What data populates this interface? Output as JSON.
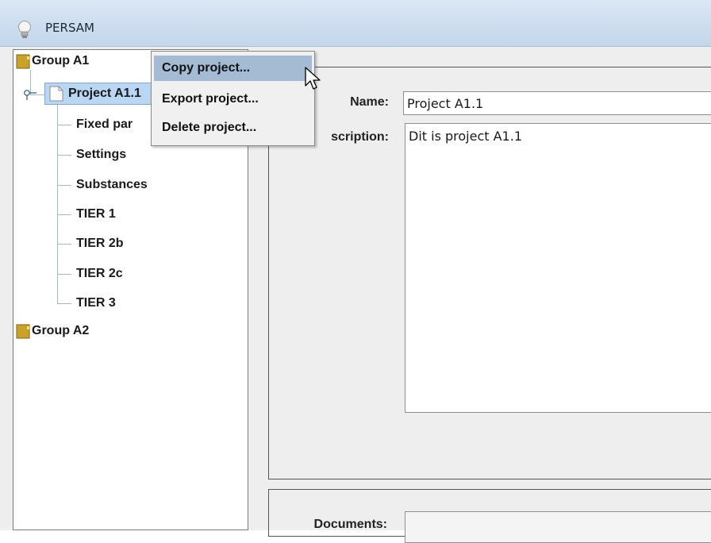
{
  "window": {
    "title": "PERSAM"
  },
  "tree": {
    "groups": [
      {
        "label": "Group A1"
      },
      {
        "label": "Group A2"
      }
    ],
    "project": {
      "label": "Project A1.1"
    },
    "children": [
      {
        "label": "Fixed par"
      },
      {
        "label": "Settings"
      },
      {
        "label": "Substances"
      },
      {
        "label": "TIER 1"
      },
      {
        "label": "TIER 2b"
      },
      {
        "label": "TIER 2c"
      },
      {
        "label": "TIER 3"
      }
    ]
  },
  "context_menu": {
    "items": [
      {
        "label": "Copy project..."
      },
      {
        "label": "Export project..."
      },
      {
        "label": "Delete project..."
      }
    ]
  },
  "form": {
    "name_label": "Name:",
    "name_value": "Project A1.1",
    "description_label": "scription:",
    "description_value": "Dit is project A1.1",
    "documents_label": "Documents:"
  },
  "colors": {
    "selection": "#b9d6f3",
    "menu_highlight": "#a5bbd3",
    "folder": "#c9a227"
  }
}
